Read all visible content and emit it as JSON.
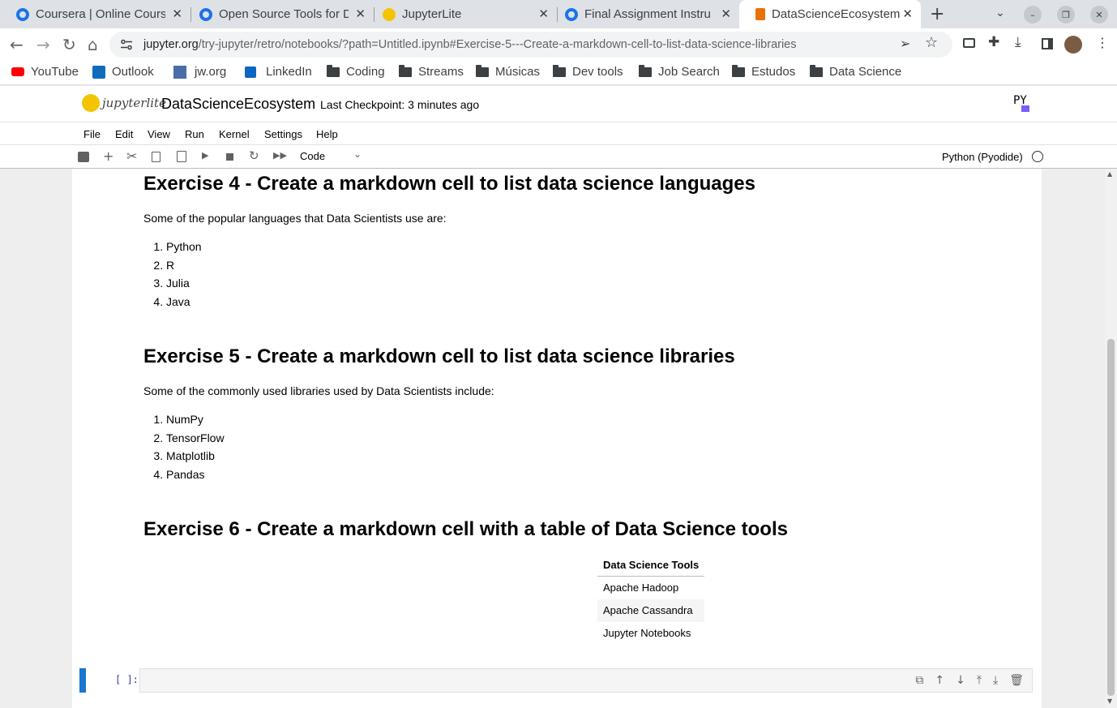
{
  "browser": {
    "tabs": [
      {
        "title": "Coursera | Online Cours",
        "icon": "google-docs-icon"
      },
      {
        "title": "Open Source Tools for D",
        "icon": "google-docs-icon"
      },
      {
        "title": "JupyterLite",
        "icon": "jupyterlite-icon"
      },
      {
        "title": "Final Assignment Instru",
        "icon": "google-docs-icon"
      },
      {
        "title": "DataScienceEcosystem",
        "icon": "notebook-icon"
      }
    ],
    "url_host": "jupyter.org",
    "url_path": "/try-jupyter/retro/notebooks/?path=Untitled.ipynb#Exercise-5---Create-a-markdown-cell-to-list-data-science-libraries",
    "bookmarks": [
      "YouTube",
      "Outlook",
      "jw.org",
      "LinkedIn",
      "Coding",
      "Streams",
      "Músicas",
      "Dev tools",
      "Job Search",
      "Estudos",
      "Data Science"
    ]
  },
  "jupyter": {
    "logo_text": "jupyterlite",
    "notebook_title": "DataScienceEcosystem",
    "checkpoint": "Last Checkpoint: 3 minutes ago",
    "py_badge": "PY",
    "menus": [
      "File",
      "Edit",
      "View",
      "Run",
      "Kernel",
      "Settings",
      "Help"
    ],
    "cell_type": "Code",
    "kernel_name": "Python (Pyodide)",
    "prompt": "[ ]:"
  },
  "notebook": {
    "ex4_heading": "Exercise 4 - Create a markdown cell to list data science languages",
    "ex4_intro": "Some of the popular languages that Data Scientists use are:",
    "languages": [
      "Python",
      "R",
      "Julia",
      "Java"
    ],
    "ex5_heading": "Exercise 5 - Create a markdown cell to list data science libraries",
    "ex5_intro": "Some of the commonly used libraries used by Data Scientists include:",
    "libraries": [
      "NumPy",
      "TensorFlow",
      "Matplotlib",
      "Pandas"
    ],
    "ex6_heading": "Exercise 6 - Create a markdown cell with a table of Data Science tools",
    "table_header": "Data Science Tools",
    "tools": [
      "Apache Hadoop",
      "Apache Cassandra",
      "Jupyter Notebooks"
    ]
  }
}
